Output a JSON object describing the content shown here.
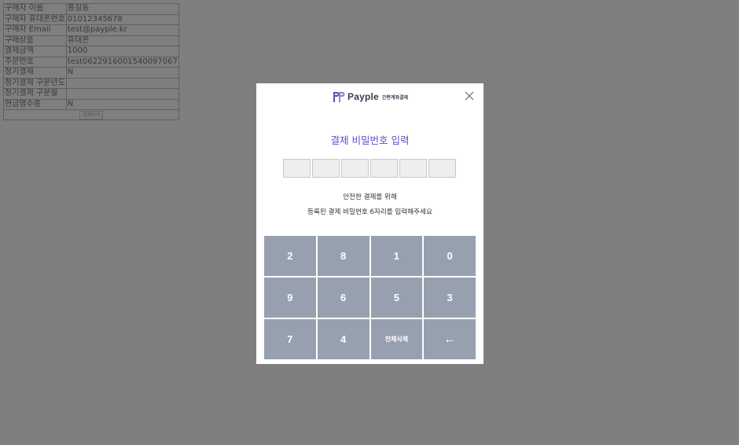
{
  "order": {
    "rows": [
      {
        "label": "구매자 이름",
        "value": "홍길동"
      },
      {
        "label": "구매자 휴대폰번호",
        "value": "01012345678"
      },
      {
        "label": "구매자 Email",
        "value": "test@payple.kr"
      },
      {
        "label": "구매상품",
        "value": "휴대폰"
      },
      {
        "label": "결제금액",
        "value": "1000"
      },
      {
        "label": "주문번호",
        "value": "test0622916001540097067"
      },
      {
        "label": "정기결제",
        "value": "N"
      },
      {
        "label": "정기결제 구분년도",
        "value": ""
      },
      {
        "label": "정기결제 구분월",
        "value": ""
      },
      {
        "label": "현금영수증",
        "value": "N"
      }
    ],
    "pay_button_label": "결제하기"
  },
  "modal": {
    "brand_name": "Payple",
    "brand_sub": "간편계좌결제",
    "close_icon": "close-icon",
    "title": "결제 비밀번호 입력",
    "pin_length": 6,
    "guide_line1": "안전한 결제를 위해",
    "guide_line2": "등록된 결제 비밀번호 6자리를 입력해주세요",
    "keypad": {
      "keys": [
        "2",
        "8",
        "1",
        "0",
        "9",
        "6",
        "5",
        "3",
        "7",
        "4",
        "전체삭제",
        "←"
      ]
    }
  },
  "colors": {
    "backdrop": "#7f7f7f",
    "title_accent": "#5b4fd1",
    "keypad_key": "#97a0ae",
    "brand_mark": "#5a50b8"
  }
}
